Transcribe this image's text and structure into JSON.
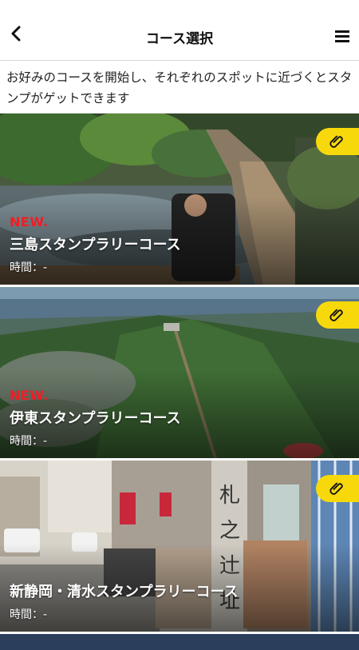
{
  "header": {
    "title": "コース選択",
    "back_icon": "chevron-left-icon",
    "menu_icon": "hamburger-menu-icon"
  },
  "intro": {
    "text": "お好みのコースを開始し、それぞれのスポットに近づくとスタンプがゲットできます"
  },
  "courses": [
    {
      "badge": "NEW.",
      "name": "三島スタンプラリーコース",
      "time": "時間：-",
      "icon": "paperclip-icon"
    },
    {
      "badge": "NEW.",
      "name": "伊東スタンプラリーコース",
      "time": "時間：-",
      "icon": "paperclip-icon"
    },
    {
      "badge": "",
      "name": "新静岡・清水スタンプラリーコース",
      "time": "時間：-",
      "icon": "paperclip-icon"
    }
  ],
  "colors": {
    "accent_yellow": "#f7d90b",
    "new_red": "#f31c25"
  }
}
